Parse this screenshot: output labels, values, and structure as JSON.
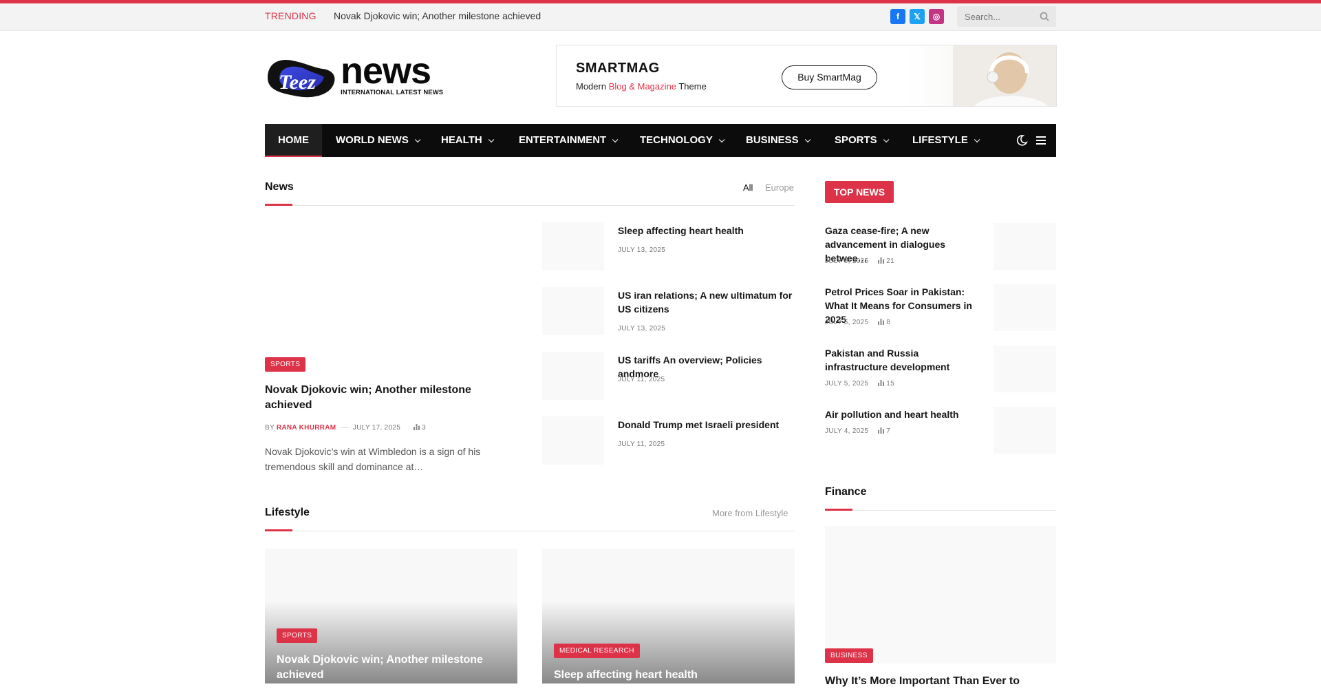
{
  "topbar": {
    "trending_label": "TRENDING",
    "trending_text": "Novak Djokovic win; Another milestone achieved",
    "social": [
      {
        "icon": "facebook-icon",
        "glyph": "f",
        "color": "#1877f2"
      },
      {
        "icon": "x-icon",
        "glyph": "𝕏",
        "color": "#1da1f2"
      },
      {
        "icon": "instagram-icon",
        "glyph": "◎",
        "color": "#c13584"
      }
    ],
    "search_placeholder": "Search..."
  },
  "logo": {
    "brand_left": "Teez",
    "brand_right": "news",
    "tagline": "INTERNATIONAL LATEST NEWS"
  },
  "ad": {
    "title": "SMARTMAG",
    "sub_a": "Modern ",
    "sub_b": "Blog & Magazine",
    "sub_c": " Theme",
    "button": "Buy SmartMag"
  },
  "nav": {
    "items": [
      "HOME",
      "WORLD NEWS",
      "HEALTH",
      "ENTERTAINMENT",
      "TECHNOLOGY",
      "BUSINESS",
      "SPORTS",
      "LIFESTYLE"
    ]
  },
  "news": {
    "title": "News",
    "filter_all": "All",
    "filter_europe": "Europe",
    "featured": {
      "category": "SPORTS",
      "headline": "Novak Djokovic win; Another milestone achieved",
      "by": "BY",
      "author": "RANA KHURRAM",
      "sep": "—",
      "date": "JULY 17, 2025",
      "views": "3",
      "excerpt": "Novak Djokovic’s win at Wimbledon is a sign of his tremendous skill and dominance at…"
    },
    "list": [
      {
        "title": "Sleep affecting heart health",
        "date": "JULY 13, 2025"
      },
      {
        "title": "US iran relations; A new ultimatum for US citizens",
        "date": "JULY 13, 2025"
      },
      {
        "title": "US tariffs An overview; Policies andmore",
        "date": "JULY 11, 2025"
      },
      {
        "title": "Donald Trump met Israeli president",
        "date": "JULY 11, 2025"
      }
    ]
  },
  "top_news": {
    "label": "TOP NEWS",
    "items": [
      {
        "title": "Gaza cease-fire; A new advancement in dialogues betwee…",
        "date": "JULY 5, 2025",
        "views": "21"
      },
      {
        "title": "Petrol Prices Soar in Pakistan: What It Means for Consumers in 2025",
        "date": "JULY 5, 2025",
        "views": "8"
      },
      {
        "title": "Pakistan and Russia infrastructure development",
        "date": "JULY 5, 2025",
        "views": "15"
      },
      {
        "title": "Air pollution and heart health",
        "date": "JULY 4, 2025",
        "views": "7"
      }
    ]
  },
  "lifestyle": {
    "title": "Lifestyle",
    "more": "More from Lifestyle",
    "cards": [
      {
        "category": "SPORTS",
        "title": "Novak Djokovic win; Another milestone achieved"
      },
      {
        "category": "MEDICAL RESEARCH",
        "title": "Sleep affecting heart health"
      }
    ]
  },
  "finance": {
    "title": "Finance",
    "category": "BUSINESS",
    "headline": "Why It’s More Important Than Ever to"
  },
  "colors": {
    "accent": "#dd3349",
    "nav_bg": "#0c0c0c"
  }
}
